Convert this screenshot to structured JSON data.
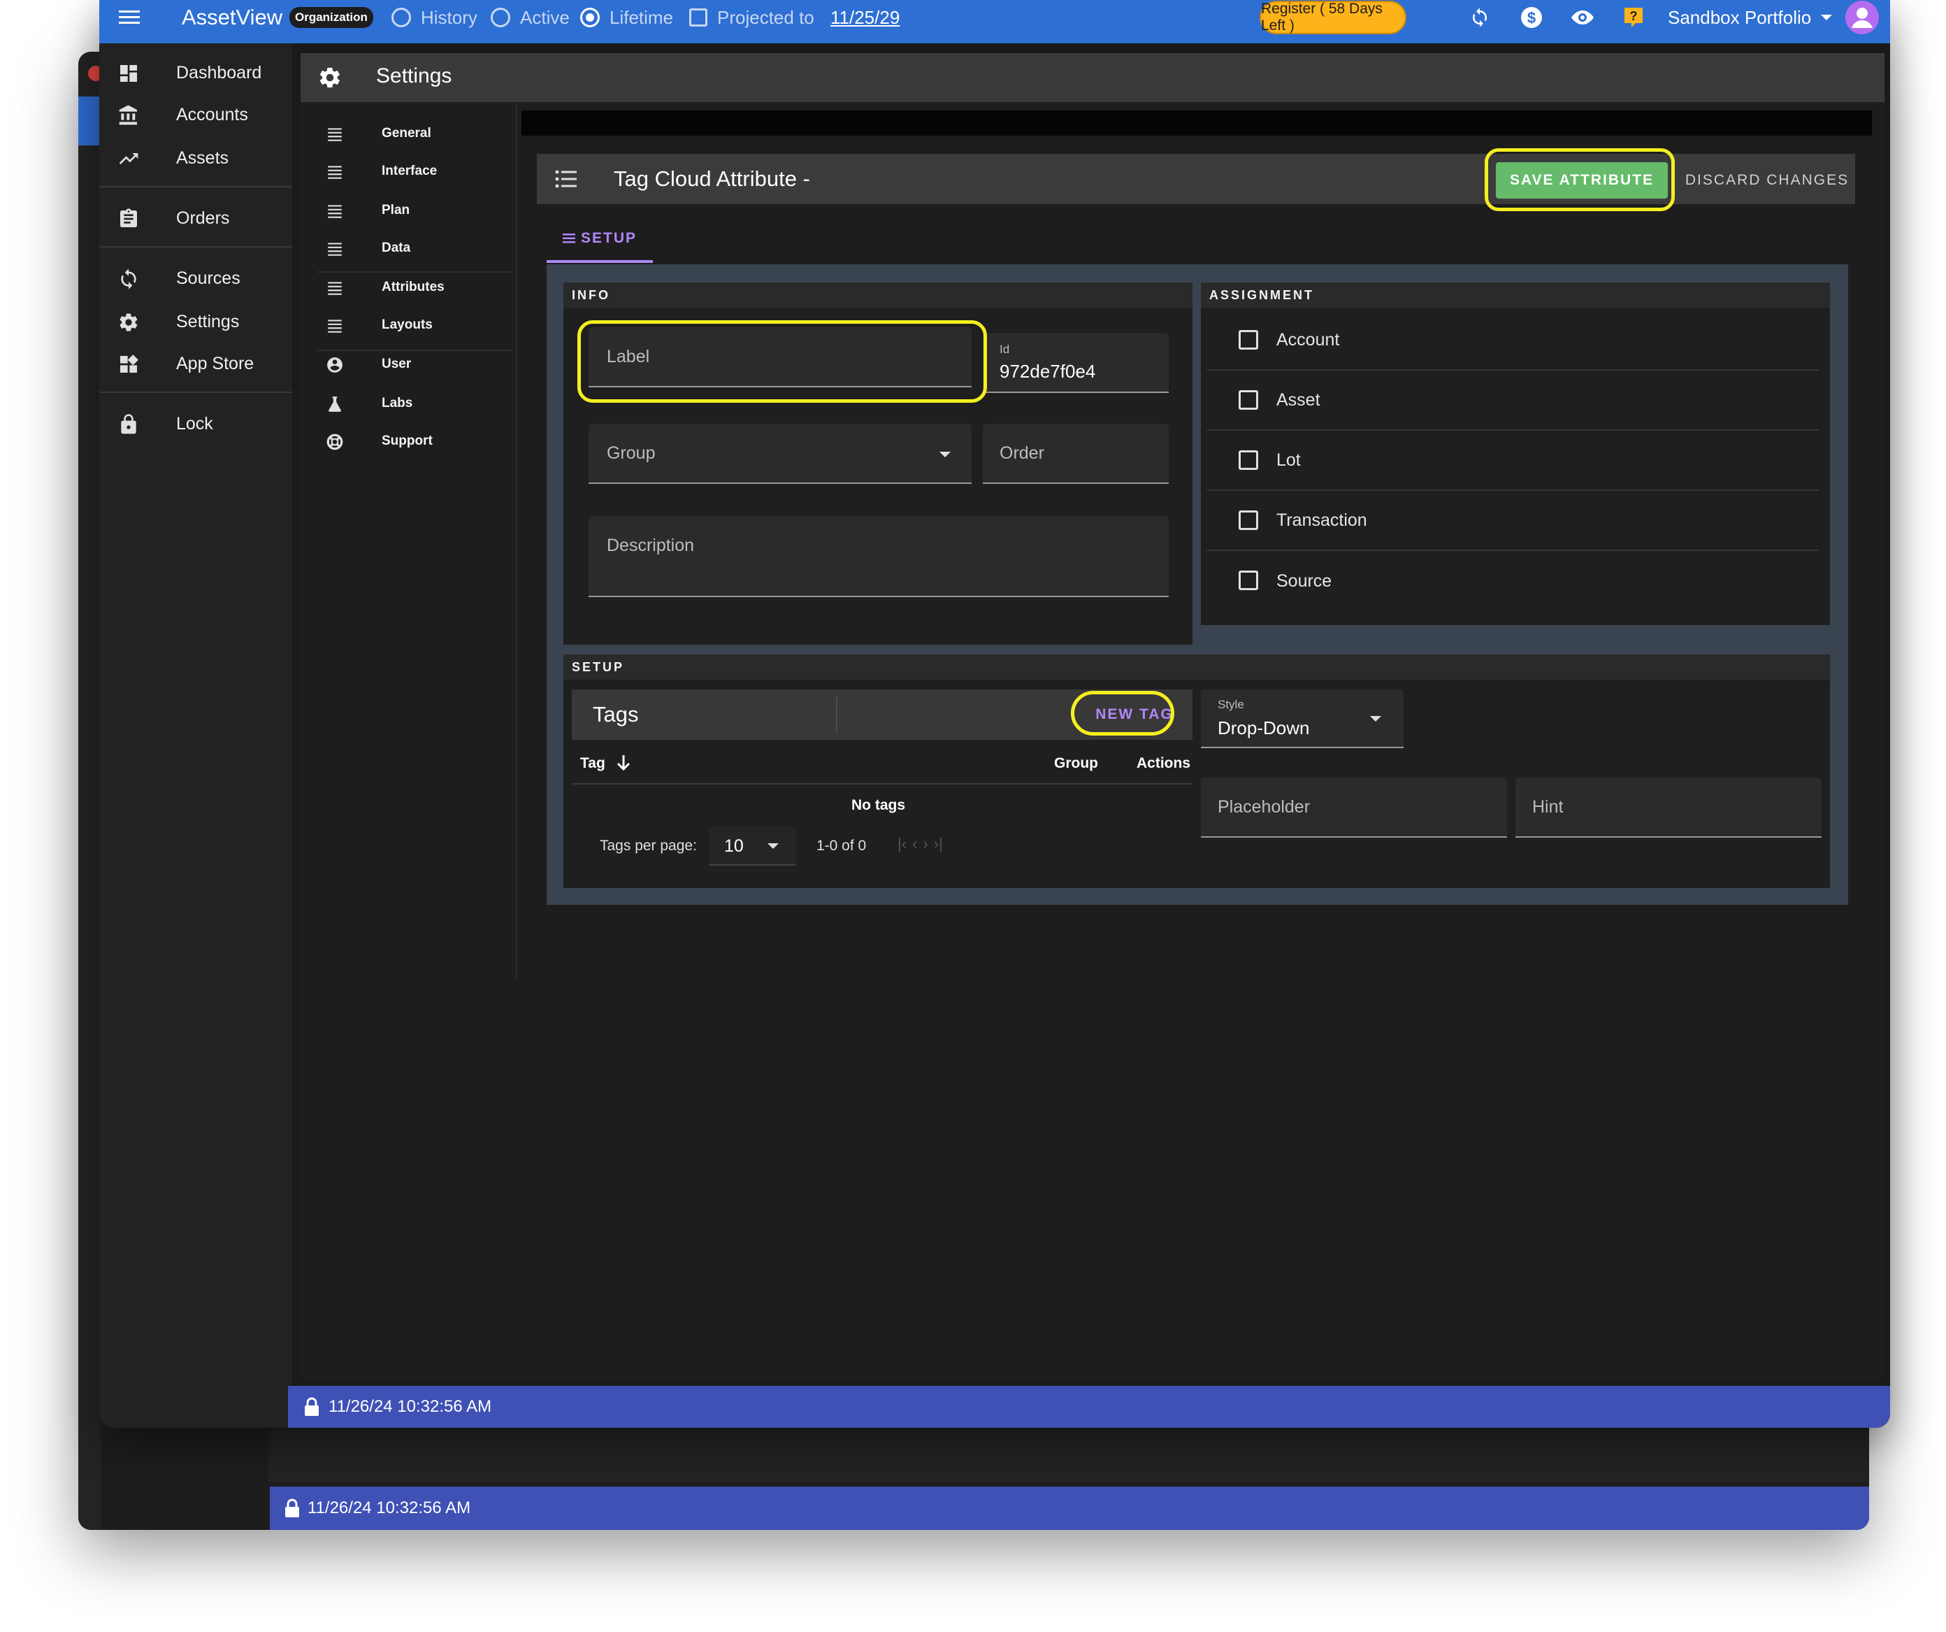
{
  "topbar": {
    "app_name": "AssetView",
    "org_badge": "Organization",
    "history": "History",
    "active": "Active",
    "lifetime": "Lifetime",
    "projected_to": "Projected to",
    "projected_date": "11/25/29",
    "register": "Register ( 58 Days Left )",
    "portfolio": "Sandbox Portfolio"
  },
  "sidebar": {
    "items": [
      {
        "label": "Dashboard",
        "icon": "dashboard-icon"
      },
      {
        "label": "Accounts",
        "icon": "bank-icon"
      },
      {
        "label": "Assets",
        "icon": "trending-up-icon"
      },
      {
        "label": "Orders",
        "icon": "clipboard-icon"
      },
      {
        "label": "Sources",
        "icon": "sync-icon"
      },
      {
        "label": "Settings",
        "icon": "gear-icon"
      },
      {
        "label": "App Store",
        "icon": "widgets-icon"
      },
      {
        "label": "Lock",
        "icon": "lock-icon"
      }
    ]
  },
  "settings": {
    "title": "Settings",
    "menu": [
      {
        "label": "General",
        "icon": "list-icon"
      },
      {
        "label": "Interface",
        "icon": "list-icon"
      },
      {
        "label": "Plan",
        "icon": "list-icon"
      },
      {
        "label": "Data",
        "icon": "list-icon"
      },
      {
        "label": "Attributes",
        "icon": "list-icon"
      },
      {
        "label": "Layouts",
        "icon": "list-icon"
      },
      {
        "label": "User",
        "icon": "account-circle-icon"
      },
      {
        "label": "Labs",
        "icon": "flask-icon"
      },
      {
        "label": "Support",
        "icon": "lifebuoy-icon"
      }
    ]
  },
  "attribute": {
    "title": "Tag Cloud Attribute -",
    "save": "SAVE ATTRIBUTE",
    "discard": "DISCARD CHANGES",
    "tab_setup": "SETUP"
  },
  "info": {
    "title": "INFO",
    "label_placeholder": "Label",
    "id_label": "Id",
    "id_value": "972de7f0e4",
    "group_placeholder": "Group",
    "order_placeholder": "Order",
    "description_placeholder": "Description"
  },
  "assignment": {
    "title": "ASSIGNMENT",
    "options": [
      "Account",
      "Asset",
      "Lot",
      "Transaction",
      "Source"
    ]
  },
  "setup": {
    "title": "SETUP",
    "tags_title": "Tags",
    "new_tag": "NEW TAG",
    "col_tag": "Tag",
    "col_group": "Group",
    "col_actions": "Actions",
    "empty": "No tags",
    "per_page_label": "Tags per page:",
    "per_page_value": "10",
    "range": "1-0 of 0",
    "style_label": "Style",
    "style_value": "Drop-Down",
    "placeholder_placeholder": "Placeholder",
    "hint_placeholder": "Hint"
  },
  "status": {
    "timestamp": "11/26/24 10:32:56 AM"
  },
  "colors": {
    "topbar": "#2e6fd3",
    "status": "#3f51b5",
    "accent_purple": "#b088f9",
    "save_green": "#66bb6a",
    "highlight": "#f5ef1f"
  }
}
